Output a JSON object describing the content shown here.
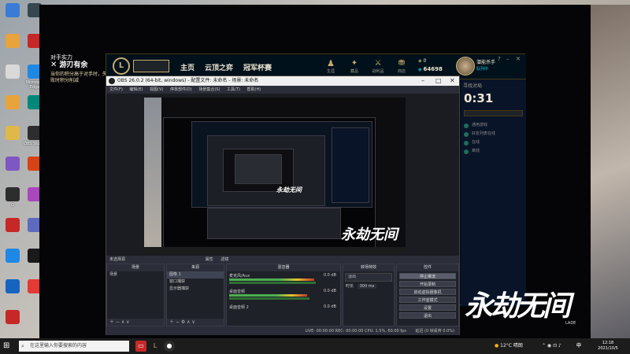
{
  "desktop": {
    "icons": [
      {
        "label": "",
        "color": "#3a7bd5"
      },
      {
        "label": "",
        "color": "#e8a33c"
      },
      {
        "label": "",
        "color": "#d9d9d9"
      },
      {
        "label": "",
        "color": "#e8a33c"
      },
      {
        "label": "",
        "color": "#e0b84a"
      },
      {
        "label": "",
        "color": "#7e57c2"
      },
      {
        "label": "G",
        "color": "#2d2d2d"
      },
      {
        "label": "",
        "color": "#c62828"
      },
      {
        "label": "",
        "color": "#1e88e5"
      },
      {
        "label": "",
        "color": "#1565c0"
      },
      {
        "label": "",
        "color": "#c62828"
      },
      {
        "label": "",
        "color": "#37474f"
      },
      {
        "label": "",
        "color": "#c62828"
      },
      {
        "label": "Microsoft Edge",
        "color": "#1e88e5"
      },
      {
        "label": "",
        "color": "#00897b"
      },
      {
        "label": "OBS Studio",
        "color": "#2d2d2d"
      },
      {
        "label": "",
        "color": "#d84315"
      },
      {
        "label": "",
        "color": "#ab47bc"
      },
      {
        "label": "",
        "color": "#5c6bc0"
      },
      {
        "label": "",
        "color": "#1a1a1a"
      },
      {
        "label": "",
        "color": "#e53935"
      }
    ]
  },
  "notice": {
    "title": "对手实力",
    "close_label": "✕",
    "headline": "游刃有余",
    "body": "当你的积分高于对手时，失败时积分削减"
  },
  "lol": {
    "play_label": "",
    "nav": [
      "主页",
      "云顶之弈",
      "冠军杯赛"
    ],
    "icons": [
      {
        "name": "profile",
        "glyph": "♟",
        "label": "生涯"
      },
      {
        "name": "collection",
        "glyph": "✦",
        "label": "藏品"
      },
      {
        "name": "loot",
        "glyph": "⚔",
        "label": "战利品"
      },
      {
        "name": "store",
        "glyph": "⛃",
        "label": "商店"
      }
    ],
    "currency_be": "0",
    "currency_rp": "64698",
    "player_name": "潜能杀手",
    "player_status": "队列中",
    "lobby_label": "寻找对局",
    "timer": "0:31",
    "queue_text": "",
    "friends": [
      "通用游戏",
      "好友列表在线",
      "在线",
      "离线"
    ]
  },
  "obs": {
    "title": "OBS 26.0.2 (64-bit, windows) - 配置文件: 未命名 - 场景: 未命名",
    "menu": [
      "文件(F)",
      "编辑(E)",
      "视图(V)",
      "停靠部件(D)",
      "场景集合(S)",
      "工具(T)",
      "帮助(H)"
    ],
    "selected_label": "未选择源",
    "props_label": "属性",
    "filters_label": "滤镜",
    "docks": {
      "scenes": {
        "title": "场景",
        "items": [
          "场景"
        ]
      },
      "sources": {
        "title": "来源",
        "items": [
          "图像 1",
          "窗口捕获",
          "显示器捕获"
        ]
      },
      "mixer": {
        "title": "混音器",
        "tracks": [
          {
            "name": "麦克风/Aux",
            "db": "0.0 dB",
            "level": 0.78
          },
          {
            "name": "桌面音频",
            "db": "0.0 dB",
            "level": 0.72
          },
          {
            "name": "桌面音频 2",
            "db": "0.0 dB",
            "level": 0.0
          }
        ]
      },
      "transitions": {
        "title": "转场特效",
        "type": "淡出",
        "duration_label": "时长",
        "duration_value": "300 ms"
      },
      "controls": {
        "title": "控件",
        "buttons": [
          "停止推流",
          "开始录制",
          "启动虚拟摄像机",
          "工作室模式",
          "设置",
          "退出"
        ]
      }
    },
    "status_bar": "LIVE: 00:00:00  REC: 00:00:00  CPU: 1.5%, 60.00 fps",
    "bottom_right": "延迟 (0 帧丢弃 0.0%)"
  },
  "watermark": {
    "stamp": "LADE"
  },
  "taskbar": {
    "search_placeholder": "在这里输入你要搜索的内容",
    "weather": "12°C 晴朗",
    "ime": "中",
    "time": "12:18",
    "date": "2021/10/5"
  }
}
